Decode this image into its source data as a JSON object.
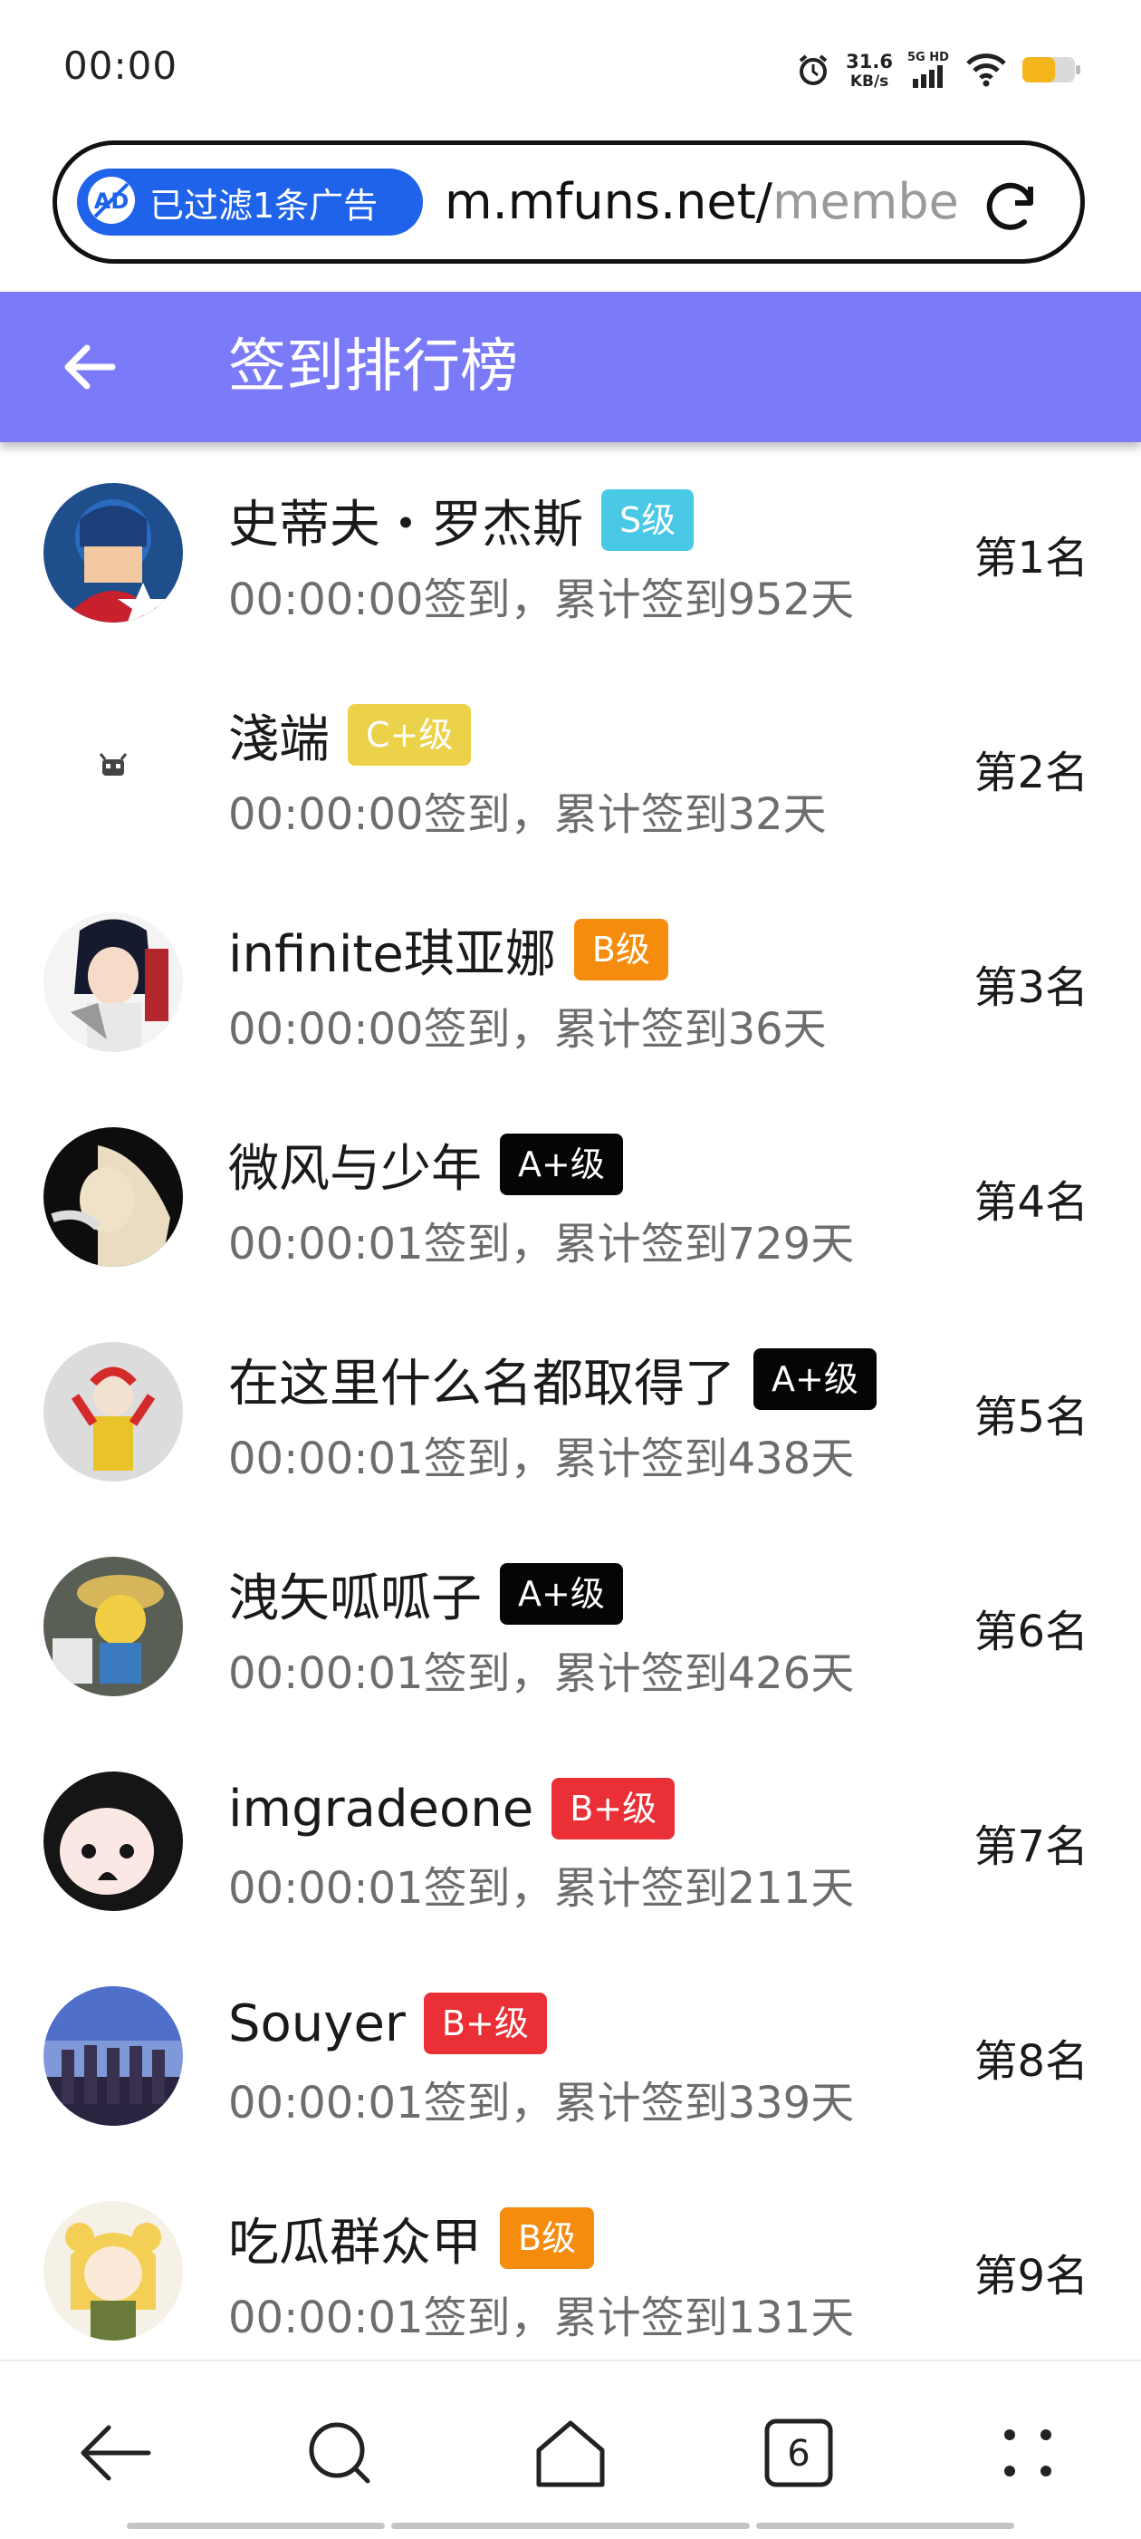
{
  "status_bar": {
    "time": "00:00",
    "net_speed": "31.6",
    "net_unit": "KB/s",
    "net_type": "5G HD",
    "battery_color": "#f5b51c"
  },
  "address_bar": {
    "ad_filter_label": "已过滤1条广告",
    "ad_icon_text": "AD",
    "url_host": "m.mfuns.net/",
    "url_path": "membe",
    "accent": "#1e63e9"
  },
  "header": {
    "title": "签到排行榜",
    "back_icon": "arrow-left-icon",
    "background": "#7b7bf9"
  },
  "ranking": [
    {
      "name": "史蒂夫・罗杰斯",
      "badge": "S级",
      "badge_style": "s",
      "checkin": "00:00:00签到，累计签到952天",
      "rank": "第1名"
    },
    {
      "name": "淺端",
      "badge": "C+级",
      "badge_style": "cplus",
      "checkin": "00:00:00签到，累计签到32天",
      "rank": "第2名"
    },
    {
      "name": "infinite琪亚娜",
      "badge": "B级",
      "badge_style": "b",
      "checkin": "00:00:00签到，累计签到36天",
      "rank": "第3名"
    },
    {
      "name": "微风与少年",
      "badge": "A+级",
      "badge_style": "aplus",
      "checkin": "00:00:01签到，累计签到729天",
      "rank": "第4名"
    },
    {
      "name": "在这里什么名都取得了",
      "badge": "A+级",
      "badge_style": "aplus",
      "checkin": "00:00:01签到，累计签到438天",
      "rank": "第5名"
    },
    {
      "name": "洩矢呱呱子",
      "badge": "A+级",
      "badge_style": "aplus",
      "checkin": "00:00:01签到，累计签到426天",
      "rank": "第6名"
    },
    {
      "name": "imgradeone",
      "badge": "B+级",
      "badge_style": "bplus",
      "checkin": "00:00:01签到，累计签到211天",
      "rank": "第7名"
    },
    {
      "name": "Souyer",
      "badge": "B+级",
      "badge_style": "bplus",
      "checkin": "00:00:01签到，累计签到339天",
      "rank": "第8名"
    },
    {
      "name": "吃瓜群众甲",
      "badge": "B级",
      "badge_style": "b",
      "checkin": "00:00:01签到，累计签到131天",
      "rank": "第9名"
    }
  ],
  "badge_colors": {
    "s": "#49c9e6",
    "cplus": "#ecd24a",
    "b": "#f58c0e",
    "aplus": "#050505",
    "bplus": "#ea2f36"
  },
  "bottom_nav": {
    "items": [
      "back-icon",
      "search-icon",
      "home-icon",
      "tabs-icon",
      "menu-dots-icon"
    ],
    "tab_count": "6"
  }
}
